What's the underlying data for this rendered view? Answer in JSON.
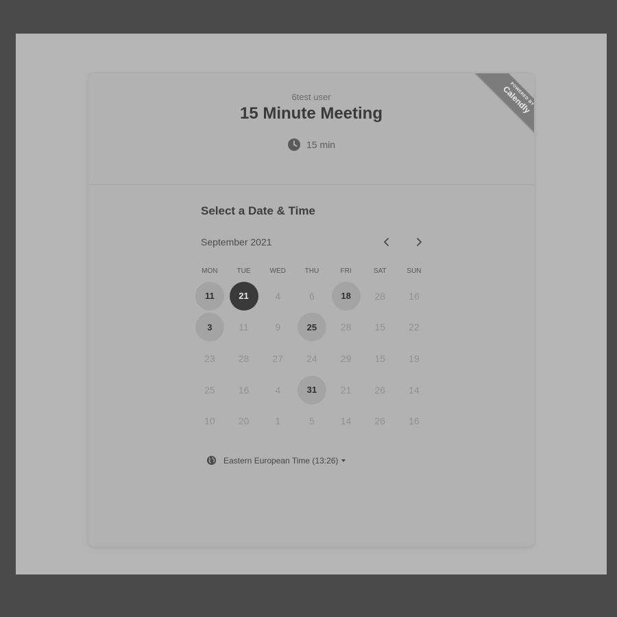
{
  "event": {
    "owner": "6test user",
    "title": "15 Minute Meeting",
    "duration": "15 min",
    "duration_icon": "clock-icon"
  },
  "branding": {
    "powered_by": "POWERED BY",
    "name": "Calendly"
  },
  "scheduler": {
    "heading": "Select a Date & Time",
    "month": "September 2021",
    "prev_icon": "chevron-left-icon",
    "next_icon": "chevron-right-icon",
    "weekdays": [
      "MON",
      "TUE",
      "WED",
      "THU",
      "FRI",
      "SAT",
      "SUN"
    ],
    "weeks": [
      [
        {
          "label": "11",
          "state": "available"
        },
        {
          "label": "21",
          "state": "selected"
        },
        {
          "label": "4",
          "state": "unavailable"
        },
        {
          "label": "6",
          "state": "unavailable"
        },
        {
          "label": "18",
          "state": "available"
        },
        {
          "label": "28",
          "state": "unavailable"
        },
        {
          "label": "16",
          "state": "unavailable"
        }
      ],
      [
        {
          "label": "3",
          "state": "available"
        },
        {
          "label": "11",
          "state": "unavailable"
        },
        {
          "label": "9",
          "state": "unavailable"
        },
        {
          "label": "25",
          "state": "available"
        },
        {
          "label": "28",
          "state": "unavailable"
        },
        {
          "label": "15",
          "state": "unavailable"
        },
        {
          "label": "22",
          "state": "unavailable"
        }
      ],
      [
        {
          "label": "23",
          "state": "unavailable"
        },
        {
          "label": "28",
          "state": "unavailable"
        },
        {
          "label": "27",
          "state": "unavailable"
        },
        {
          "label": "24",
          "state": "unavailable"
        },
        {
          "label": "29",
          "state": "unavailable"
        },
        {
          "label": "15",
          "state": "unavailable"
        },
        {
          "label": "19",
          "state": "unavailable"
        }
      ],
      [
        {
          "label": "25",
          "state": "unavailable"
        },
        {
          "label": "16",
          "state": "unavailable"
        },
        {
          "label": "4",
          "state": "unavailable"
        },
        {
          "label": "31",
          "state": "available"
        },
        {
          "label": "21",
          "state": "unavailable"
        },
        {
          "label": "26",
          "state": "unavailable"
        },
        {
          "label": "14",
          "state": "unavailable"
        }
      ],
      [
        {
          "label": "10",
          "state": "unavailable"
        },
        {
          "label": "20",
          "state": "unavailable"
        },
        {
          "label": "1",
          "state": "unavailable"
        },
        {
          "label": "5",
          "state": "unavailable"
        },
        {
          "label": "14",
          "state": "unavailable"
        },
        {
          "label": "26",
          "state": "unavailable"
        },
        {
          "label": "16",
          "state": "unavailable"
        }
      ]
    ]
  },
  "timezone": {
    "label": "Eastern European Time (13:26)",
    "icon": "globe-icon"
  },
  "colors": {
    "backdrop": "#4a4a4a",
    "card": "#b2b2b2",
    "selected_day": "#3a3a3a",
    "available_day": "#a4a4a4",
    "ribbon": "#7c7c7c"
  }
}
